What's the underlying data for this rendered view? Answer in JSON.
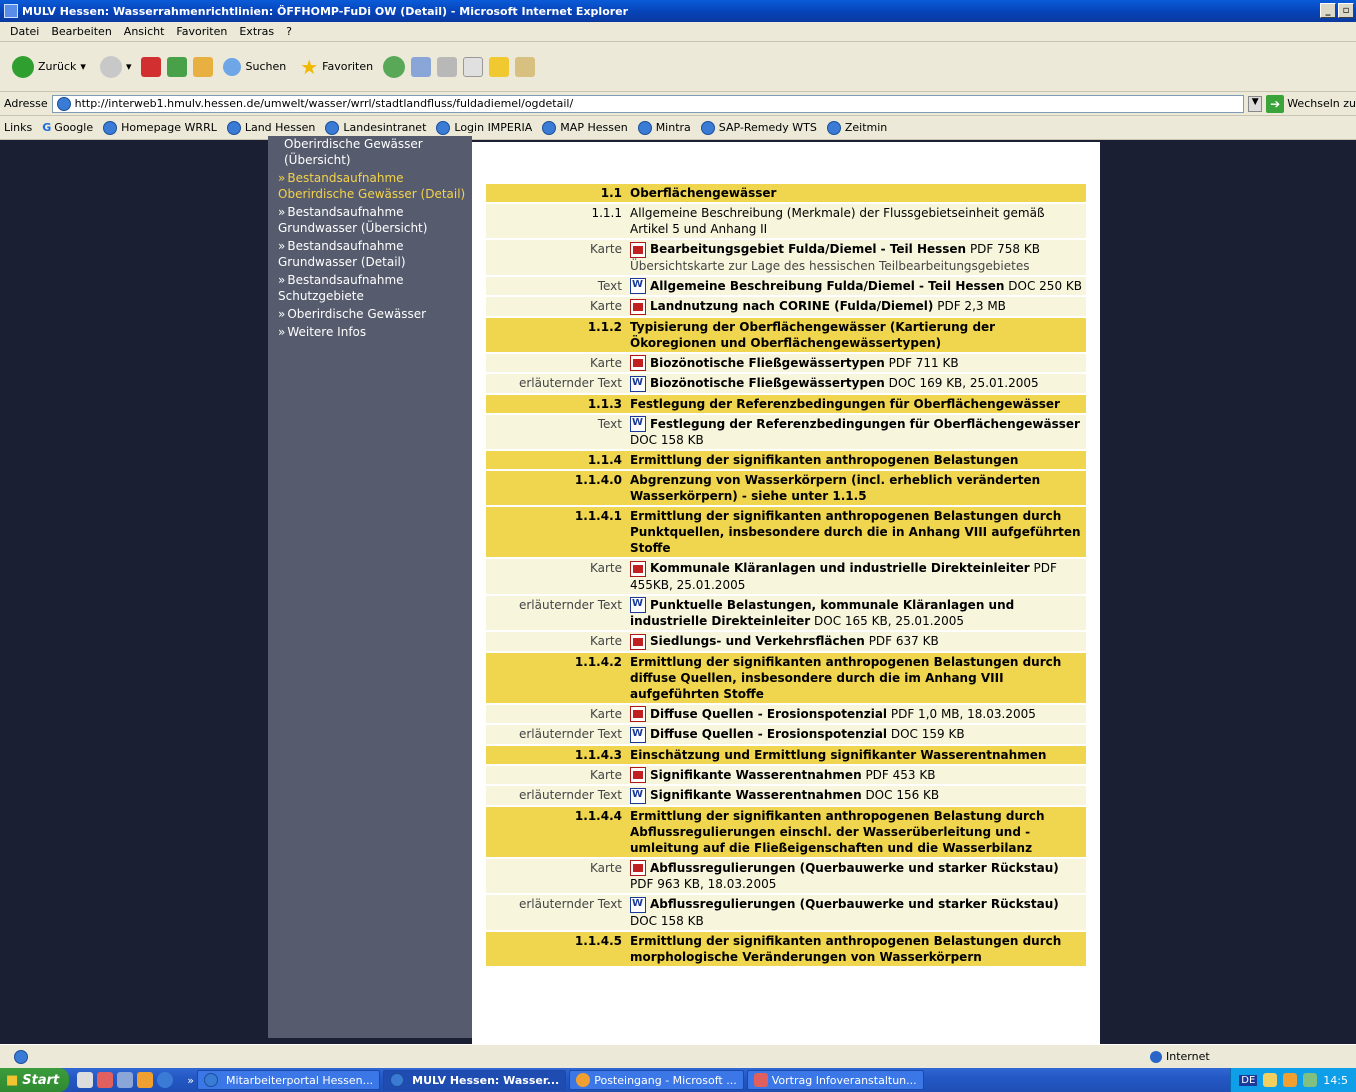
{
  "window": {
    "title": "MULV Hessen: Wasserrahmenrichtlinien: ÖFFHOMP-FuDi OW (Detail) - Microsoft Internet Explorer"
  },
  "menu": [
    "Datei",
    "Bearbeiten",
    "Ansicht",
    "Favoriten",
    "Extras",
    "?"
  ],
  "toolbar": {
    "back": "Zurück",
    "search": "Suchen",
    "favorites": "Favoriten"
  },
  "address": {
    "label": "Adresse",
    "url": "http://interweb1.hmulv.hessen.de/umwelt/wasser/wrrl/stadtlandfluss/fuldadiemel/ogdetail/",
    "go": "Wechseln zu"
  },
  "links": {
    "label": "Links",
    "items": [
      "Google",
      "Homepage WRRL",
      "Land Hessen",
      "Landesintranet",
      "Login IMPERIA",
      "MAP Hessen",
      "Mintra",
      "SAP-Remedy WTS",
      "Zeitmin"
    ]
  },
  "sidebar": {
    "items": [
      {
        "text": "Oberirdische Gewässer (Übersicht)",
        "active": false,
        "arrow": false
      },
      {
        "text": "Bestandsaufnahme Oberirdische Gewässer (Detail)",
        "active": true,
        "arrow": true
      },
      {
        "text": "Bestandsaufnahme Grundwasser (Übersicht)",
        "active": false,
        "arrow": true
      },
      {
        "text": "Bestandsaufnahme Grundwasser (Detail)",
        "active": false,
        "arrow": true
      },
      {
        "text": "Bestandsaufnahme Schutzgebiete",
        "active": false,
        "arrow": true
      },
      {
        "text": "Oberirdische Gewässer",
        "active": false,
        "arrow": true
      },
      {
        "text": "Weitere Infos",
        "active": false,
        "arrow": true
      }
    ]
  },
  "content": {
    "rows": [
      {
        "type": "h",
        "num": "1.1",
        "text": "Oberflächengewässer"
      },
      {
        "type": "p",
        "num": "1.1.1",
        "text": "Allgemeine Beschreibung (Merkmale) der Flussgebietseinheit gemäß Artikel 5 und Anhang II"
      },
      {
        "type": "d",
        "label": "Karte",
        "icon": "pdf",
        "title": "Bearbeitungsgebiet Fulda/Diemel - Teil Hessen",
        "meta": "PDF 758 KB",
        "sub": "Übersichtskarte zur Lage des hessischen Teilbearbeitungsgebietes"
      },
      {
        "type": "d",
        "label": "Text",
        "icon": "doc",
        "title": "Allgemeine Beschreibung Fulda/Diemel - Teil Hessen",
        "meta": "DOC 250 KB"
      },
      {
        "type": "d",
        "label": "Karte",
        "icon": "pdf",
        "title": "Landnutzung nach CORINE (Fulda/Diemel)",
        "meta": "PDF 2,3 MB"
      },
      {
        "type": "h",
        "num": "1.1.2",
        "text": "Typisierung der Oberflächengewässer (Kartierung der Ökoregionen und Oberflächengewässertypen)"
      },
      {
        "type": "d",
        "label": "Karte",
        "icon": "pdf",
        "title": "Biozönotische Fließgewässertypen",
        "meta": "PDF 711 KB"
      },
      {
        "type": "d",
        "label": "erläuternder Text",
        "icon": "doc",
        "title": "Biozönotische Fließgewässertypen",
        "meta": "DOC 169 KB, 25.01.2005"
      },
      {
        "type": "h",
        "num": "1.1.3",
        "text": "Festlegung der Referenzbedingungen für Oberflächengewässer"
      },
      {
        "type": "d",
        "label": "Text",
        "icon": "doc",
        "title": "Festlegung der Referenzbedingungen für Oberflächengewässer",
        "meta": "DOC 158 KB"
      },
      {
        "type": "h",
        "num": "1.1.4",
        "text": "Ermittlung der signifikanten anthropogenen Belastungen"
      },
      {
        "type": "h",
        "num": "1.1.4.0",
        "text": "Abgrenzung von Wasserkörpern (incl. erheblich veränderten Wasserkörpern) - siehe unter 1.1.5"
      },
      {
        "type": "h",
        "num": "1.1.4.1",
        "text": "Ermittlung der signifikanten anthropogenen Belastungen durch Punktquellen, insbesondere durch die in Anhang VIII aufgeführten Stoffe"
      },
      {
        "type": "d",
        "label": "Karte",
        "icon": "pdf",
        "title": "Kommunale Kläranlagen und industrielle Direkteinleiter",
        "meta": "PDF 455KB, 25.01.2005"
      },
      {
        "type": "d",
        "label": "erläuternder Text",
        "icon": "doc",
        "title": "Punktuelle Belastungen, kommunale Kläranlagen und industrielle Direkteinleiter",
        "meta": "DOC 165 KB, 25.01.2005"
      },
      {
        "type": "d",
        "label": "Karte",
        "icon": "pdf",
        "title": "Siedlungs- und Verkehrsflächen",
        "meta": "PDF 637 KB"
      },
      {
        "type": "h",
        "num": "1.1.4.2",
        "text": "Ermittlung der signifikanten anthropogenen Belastungen durch diffuse Quellen, insbesondere durch die im Anhang VIII aufgeführten Stoffe"
      },
      {
        "type": "d",
        "label": "Karte",
        "icon": "pdf",
        "title": "Diffuse Quellen - Erosionspotenzial",
        "meta": "PDF 1,0 MB, 18.03.2005"
      },
      {
        "type": "d",
        "label": "erläuternder Text",
        "icon": "doc",
        "title": "Diffuse Quellen - Erosionspotenzial",
        "meta": "DOC 159 KB"
      },
      {
        "type": "h",
        "num": "1.1.4.3",
        "text": "Einschätzung und Ermittlung signifikanter Wasserentnahmen"
      },
      {
        "type": "d",
        "label": "Karte",
        "icon": "pdf",
        "title": "Signifikante Wasserentnahmen",
        "meta": "PDF 453 KB"
      },
      {
        "type": "d",
        "label": "erläuternder Text",
        "icon": "doc",
        "title": "Signifikante Wasserentnahmen",
        "meta": "DOC 156 KB"
      },
      {
        "type": "h",
        "num": "1.1.4.4",
        "text": "Ermittlung der signifikanten anthropogenen Belastung durch Abflussregulierungen einschl. der Wasserüberleitung und -umleitung auf die Fließeigenschaften und die Wasserbilanz"
      },
      {
        "type": "d",
        "label": "Karte",
        "icon": "pdf",
        "title": "Abflussregulierungen (Querbauwerke und starker Rückstau)",
        "meta": "PDF 963 KB, 18.03.2005"
      },
      {
        "type": "d",
        "label": "erläuternder Text",
        "icon": "doc",
        "title": "Abflussregulierungen (Querbauwerke und starker Rückstau)",
        "meta": "DOC 158 KB"
      },
      {
        "type": "h",
        "num": "1.1.4.5",
        "text": "Ermittlung der signifikanten anthropogenen Belastungen durch morphologische Veränderungen von Wasserkörpern"
      }
    ]
  },
  "status": {
    "zone": "Internet"
  },
  "taskbar": {
    "start": "Start",
    "chevron": "»",
    "tasks": [
      "Mitarbeiterportal Hessen...",
      "MULV Hessen: Wasser...",
      "Posteingang - Microsoft ...",
      "Vortrag Infoveranstaltun..."
    ],
    "clock": "14:5",
    "lang": "DE"
  }
}
